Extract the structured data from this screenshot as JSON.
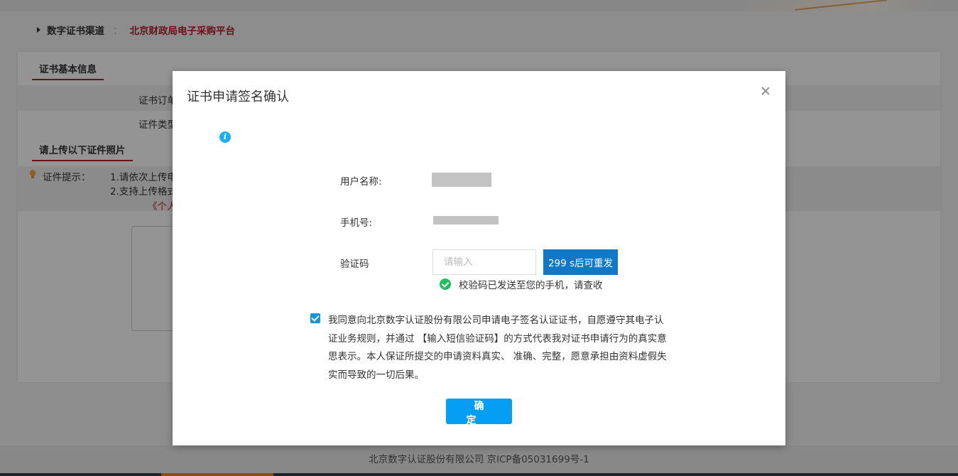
{
  "breadcrumb": {
    "channel_label": "数字证书渠道",
    "separator": "：",
    "platform_name": "北京财政局电子采购平台"
  },
  "page": {
    "section_basic_info": "证书基本信息",
    "field_order_partial": "证书订单",
    "field_type_partial": "证件类型",
    "section_upload": "请上传以下证件照片",
    "hint_label": "证件提示：",
    "hint_line_1": "1.请依次上传申",
    "hint_line_2": "2.支持上传格式",
    "hint_red": "《个人"
  },
  "footer": {
    "text": "北京数字认证股份有限公司 京ICP备05031699号-1"
  },
  "modal": {
    "title": "证书申请签名确认",
    "username_label": "用户名称:",
    "phone_label": "手机号:",
    "code_label": "验证码",
    "code_placeholder": "请输入",
    "resend_label": "299 s后可重发",
    "sent_message": "校验码已发送至您的手机，请查收",
    "agreement_text": "我同意向北京数字认证股份有限公司申请电子签名认证证书，自愿遵守其电子认证业务规则，并通过 【输入短信验证码】的方式代表我对证书申请行为的真实意思表示。本人保证所提交的申请资料真实、 准确、完整，愿意承担由资料虚假失实而导致的一切后果。",
    "agreement_checked": true,
    "confirm_label": "确定"
  },
  "colors": {
    "brand_red": "#b41f2e",
    "resend_blue": "#1178c8",
    "confirm_blue": "#049ef4",
    "success_green": "#1ebf60",
    "info_cyan": "#1ab0ef"
  }
}
